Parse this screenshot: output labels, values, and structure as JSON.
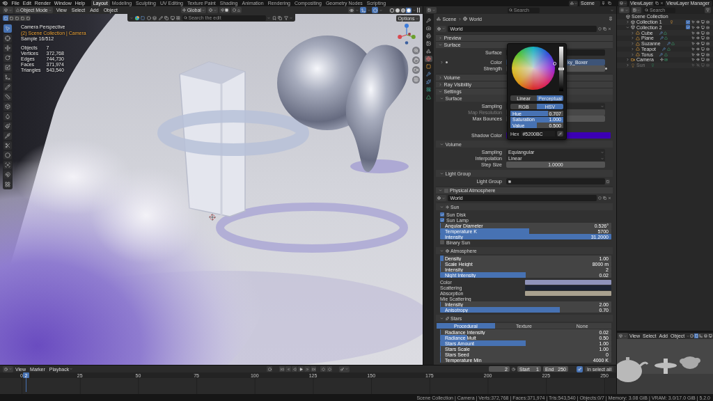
{
  "topbar": {
    "menus": [
      "File",
      "Edit",
      "Render",
      "Window",
      "Help"
    ],
    "workspaces": [
      {
        "label": "Layout",
        "selected": true
      },
      {
        "label": "Modeling",
        "selected": false
      },
      {
        "label": "Sculpting",
        "selected": false
      },
      {
        "label": "UV Editing",
        "selected": false
      },
      {
        "label": "Texture Paint",
        "selected": false
      },
      {
        "label": "Shading",
        "selected": false
      },
      {
        "label": "Animation",
        "selected": false
      },
      {
        "label": "Rendering",
        "selected": false
      },
      {
        "label": "Compositing",
        "selected": false
      },
      {
        "label": "Geometry Nodes",
        "selected": false
      },
      {
        "label": "Scripting",
        "selected": false
      }
    ],
    "scene": "Scene",
    "view_layer": "ViewLayer",
    "view_layer_manager": "ViewLayer Manager"
  },
  "viewport": {
    "mode": "Object Mode",
    "menus": [
      "View",
      "Select",
      "Add",
      "Object"
    ],
    "orientation": "Global",
    "view_toggles": [
      {
        "selected": false
      },
      {
        "selected": true
      },
      {
        "selected": true
      }
    ],
    "shading": [
      {
        "selected": false
      },
      {
        "selected": false
      },
      {
        "selected": false
      },
      {
        "selected": true
      }
    ],
    "select_modes": [
      {
        "selected": true
      },
      {
        "selected": false
      },
      {
        "selected": false
      },
      {
        "selected": false
      },
      {
        "selected": false
      }
    ],
    "search": {
      "placeholder": "Search the edit"
    },
    "options": "Options",
    "tools": [
      {
        "selected": true
      },
      {
        "selected": false
      },
      {
        "selected": false
      },
      {
        "selected": false
      },
      {
        "selected": false
      },
      {
        "selected": false
      },
      {
        "selected": false
      },
      {
        "selected": false
      },
      {
        "selected": false
      },
      {
        "selected": false
      },
      {
        "selected": false
      },
      {
        "selected": false
      },
      {
        "selected": false
      },
      {
        "selected": false
      },
      {
        "selected": false
      },
      {
        "selected": false
      },
      {
        "selected": false
      }
    ],
    "overlay": {
      "view": "Camera Perspective",
      "collection": "(2) Scene Collection | Camera",
      "samples": "Sample 16/512",
      "stats": [
        {
          "label": "Objects",
          "value": "7"
        },
        {
          "label": "Vertices",
          "value": "372,768"
        },
        {
          "label": "Edges",
          "value": "744,730"
        },
        {
          "label": "Faces",
          "value": "371,974"
        },
        {
          "label": "Triangles",
          "value": "543,540"
        }
      ]
    }
  },
  "properties": {
    "search": {
      "placeholder": "Search"
    },
    "tabs": [
      {
        "selected": false
      },
      {
        "selected": false
      },
      {
        "selected": false
      },
      {
        "selected": false
      },
      {
        "selected": false
      },
      {
        "selected": true
      },
      {
        "selected": false
      },
      {
        "selected": false
      },
      {
        "selected": false
      },
      {
        "selected": false
      },
      {
        "selected": false
      }
    ],
    "breadcrumb": [
      "Scene",
      "World"
    ],
    "world": "World",
    "items": [
      {
        "kind": "panel",
        "label": "Preview",
        "expanded": false
      },
      {
        "kind": "panel",
        "label": "Surface",
        "expanded": true
      },
      {
        "kind": "field",
        "label": "Surface"
      },
      {
        "kind": "link",
        "label": "Color",
        "value": "ky_Boxer"
      },
      {
        "kind": "number",
        "label": "Strength",
        "disabled": false,
        "decorated": true
      },
      {
        "kind": "panel",
        "label": "Volume",
        "expanded": false
      },
      {
        "kind": "panel",
        "label": "Ray Visibility",
        "expanded": false
      },
      {
        "kind": "panel",
        "label": "Settings",
        "expanded": true
      },
      {
        "kind": "subpanel",
        "label": "Surface",
        "expanded": true,
        "icon": false
      },
      {
        "kind": "dropdown",
        "label": "Sampling"
      },
      {
        "kind": "number",
        "label": "Map Resolution",
        "disabled": true,
        "decorated": false
      },
      {
        "kind": "number",
        "label": "Max Bounces",
        "disabled": false,
        "decorated": false
      },
      {
        "kind": "color_field",
        "label": "Shadow Color",
        "color": "#3c00b4"
      },
      {
        "kind": "subpanel",
        "label": "Volume",
        "expanded": true,
        "icon": false
      },
      {
        "kind": "dropdown",
        "label": "Sampling",
        "value": "Equiangular"
      },
      {
        "kind": "dropdown",
        "label": "Interpolation",
        "value": "Linear"
      },
      {
        "kind": "number",
        "label": "Step Size",
        "value": "1.0000",
        "disabled": false,
        "decorated": false
      },
      {
        "kind": "subpanel",
        "label": "Light Group",
        "expanded": true,
        "icon": false
      },
      {
        "kind": "search",
        "label": "Light Group"
      },
      {
        "kind": "panel",
        "label": "Physical Atmosphere",
        "expanded": true,
        "checked": false
      },
      {
        "kind": "datablock",
        "value": "World"
      },
      {
        "kind": "subpanel",
        "label": "Sun",
        "expanded": true,
        "icon": true
      },
      {
        "kind": "checkbox",
        "label": "Sun Disk",
        "checked": true
      },
      {
        "kind": "checkbox",
        "label": "Sun Lamp",
        "checked": true
      },
      {
        "kind": "slider",
        "label": "Angular Diameter",
        "level": 0,
        "value": "0.526°"
      },
      {
        "kind": "slider",
        "label": "Temperature K",
        "level": 0.52,
        "value": "5700"
      },
      {
        "kind": "slider",
        "label": "Intensity",
        "level": 1,
        "value": "31.2000"
      },
      {
        "kind": "checkbox",
        "label": "Binary Sun",
        "checked": false
      },
      {
        "kind": "subpanel",
        "label": "Atmosphere",
        "expanded": true,
        "icon": true
      },
      {
        "kind": "slider",
        "label": "Density",
        "level": 0.02,
        "value": "1.00"
      },
      {
        "kind": "slider",
        "label": "Scale Height",
        "level": 0,
        "value": "8000 m"
      },
      {
        "kind": "slider",
        "label": "Intensity",
        "level": 0,
        "value": "2"
      },
      {
        "kind": "slider",
        "label": "Night Intensity",
        "level": 0.5,
        "value": "0.02"
      },
      {
        "kind": "color_row",
        "label": "Color",
        "color": "#8f93b9"
      },
      {
        "kind": "color_row",
        "label": "Scattering",
        "color": "#1d2432"
      },
      {
        "kind": "color_row",
        "label": "Absorption",
        "color": "#a9a18f"
      },
      {
        "kind": "label",
        "label": "Mie Scattering"
      },
      {
        "kind": "slider",
        "label": "Intensity",
        "level": 0,
        "value": "2.00"
      },
      {
        "kind": "slider",
        "label": "Anisotropy",
        "level": 0.7,
        "value": "0.70"
      },
      {
        "kind": "subpanel",
        "label": "Stars",
        "expanded": true,
        "icon": true
      },
      {
        "kind": "tabs",
        "tabs": [
          {
            "label": "Procedural",
            "selected": true
          },
          {
            "label": "Texture",
            "selected": false
          },
          {
            "label": "None",
            "selected": false
          }
        ]
      },
      {
        "kind": "slider",
        "label": "Radiance Intensity",
        "level": 0,
        "value": "0.02"
      },
      {
        "kind": "slider",
        "label": "Radiance Mult",
        "level": 0.16,
        "value": "0.50"
      },
      {
        "kind": "slider",
        "label": "Stars Amount",
        "level": 0.5,
        "value": "1.00"
      },
      {
        "kind": "slider",
        "label": "Stars Scale",
        "level": 0,
        "value": "1.00"
      },
      {
        "kind": "slider",
        "label": "Stars Seed",
        "level": 0,
        "value": "0"
      },
      {
        "kind": "slider",
        "label": "Temperature Min",
        "level": 0,
        "value": "4000 K"
      }
    ]
  },
  "color_picker": {
    "modes": [
      {
        "label": "Linear",
        "selected": false
      },
      {
        "label": "Perceptual",
        "selected": true
      }
    ],
    "models": [
      {
        "label": "RGB",
        "selected": false
      },
      {
        "label": "HSV",
        "selected": true
      }
    ],
    "sliders": [
      {
        "label": "Hue",
        "level": 0.707,
        "reading": "0.707"
      },
      {
        "label": "Saturation",
        "level": 1,
        "reading": "1.000"
      },
      {
        "label": "Value",
        "level": 0.5,
        "reading": "0.500"
      }
    ],
    "hex_label": "Hex",
    "hex": "#5200BC"
  },
  "outliner": {
    "search": {
      "placeholder": "Search"
    },
    "tree": [
      {
        "label": "Scene Collection",
        "kind": "scene",
        "disabled": false,
        "children": [
          {
            "label": "Collection 1",
            "kind": "collection",
            "expanded": false,
            "checked": true,
            "disabled": false
          },
          {
            "label": "Collection 2",
            "kind": "collection",
            "expanded": true,
            "checked": true,
            "disabled": false,
            "children": [
              {
                "label": "Cube",
                "kind": "mesh",
                "expanded": false,
                "disabled": false
              },
              {
                "label": "Plane",
                "kind": "mesh",
                "expanded": false,
                "disabled": false
              },
              {
                "label": "Suzanne",
                "kind": "mesh",
                "expanded": false,
                "disabled": false
              },
              {
                "label": "Teapot",
                "kind": "mesh",
                "expanded": false,
                "disabled": false
              },
              {
                "label": "Torus",
                "kind": "mesh",
                "expanded": false,
                "disabled": false
              }
            ]
          },
          {
            "label": "Camera",
            "kind": "camera",
            "expanded": false,
            "disabled": false
          },
          {
            "label": "Sun",
            "kind": "light",
            "expanded": false,
            "disabled": true
          }
        ]
      }
    ]
  },
  "mini_viewport": {
    "menus": [
      "View",
      "Select",
      "Add",
      "Object"
    ],
    "toggles": [
      {
        "selected": false
      },
      {
        "selected": true
      },
      {
        "selected": false
      },
      {
        "selected": false
      },
      {
        "selected": false
      }
    ]
  },
  "timeline": {
    "menus": [
      "View",
      "Marker",
      "Playback"
    ],
    "frame": "2",
    "start_label": "Start",
    "start": "1",
    "end_label": "End",
    "end": "250",
    "keying": "In select all",
    "ruler": [
      "0",
      "25",
      "50",
      "75",
      "100",
      "125",
      "150",
      "175",
      "200",
      "225",
      "250"
    ],
    "playhead": "2"
  },
  "status_bar": "Scene Collection | Camera | Verts:372,768 | Faces:371,974 | Tris:543,540 | Objects:0/7 | Memory: 3.08 GiB | VRAM: 3.0/17.0 GiB | 5.2.0"
}
